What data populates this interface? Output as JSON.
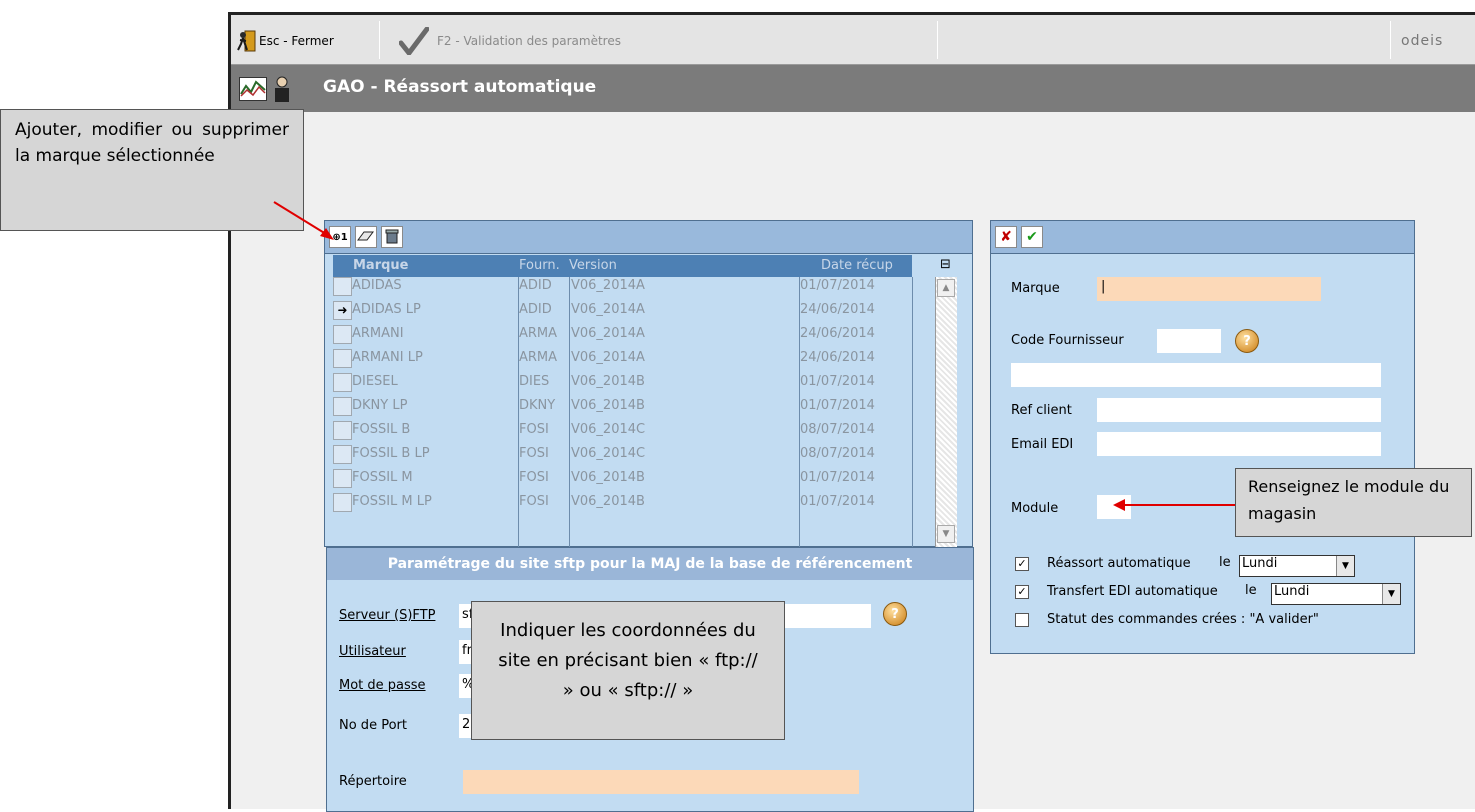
{
  "toolbar": {
    "close_label": "Esc - Fermer",
    "validate_label": "F2 - Validation des paramètres",
    "logo": "odeis"
  },
  "window": {
    "title": "GAO - Réassort automatique"
  },
  "brand_grid": {
    "columns": [
      "Marque",
      "Fourn.",
      "Version",
      "Date récup"
    ],
    "rows": [
      [
        "ADIDAS",
        "ADID",
        "V06_2014A",
        "01/07/2014"
      ],
      [
        "ADIDAS LP",
        "ADID",
        "V06_2014A",
        "24/06/2014"
      ],
      [
        "ARMANI",
        "ARMA",
        "V06_2014A",
        "24/06/2014"
      ],
      [
        "ARMANI LP",
        "ARMA",
        "V06_2014A",
        "24/06/2014"
      ],
      [
        "DIESEL",
        "DIES",
        "V06_2014B",
        "01/07/2014"
      ],
      [
        "DKNY LP",
        "DKNY",
        "V06_2014B",
        "01/07/2014"
      ],
      [
        "FOSSIL B",
        "FOSI",
        "V06_2014C",
        "08/07/2014"
      ],
      [
        "FOSSIL B LP",
        "FOSI",
        "V06_2014C",
        "08/07/2014"
      ],
      [
        "FOSSIL M",
        "FOSI",
        "V06_2014B",
        "01/07/2014"
      ],
      [
        "FOSSIL M LP",
        "FOSI",
        "V06_2014B",
        "01/07/2014"
      ]
    ],
    "selected_row": 1
  },
  "sftp": {
    "header": "Paramétrage du site sftp pour la MAJ de la base de référencement",
    "server_label": "Serveur (S)FTP",
    "server_value": "sf",
    "user_label": "Utilisateur",
    "user_value": "fr",
    "password_label": "Mot de passe",
    "password_value": "%",
    "port_label": "No de Port",
    "port_value": "2",
    "directory_label": "Répertoire",
    "directory_value": ""
  },
  "detail": {
    "marque_label": "Marque",
    "marque_value": "|",
    "code_fournisseur_label": "Code Fournisseur",
    "code_fournisseur_value": "",
    "ref_client_label": "Ref client",
    "ref_client_value": "",
    "email_edi_label": "Email EDI",
    "email_edi_value": "",
    "module_label": "Module",
    "module_value": "",
    "reassort_label": "Réassort automatique",
    "reassort_checked": true,
    "reassort_le": "le",
    "reassort_day": "Lundi",
    "transfert_label": "Transfert EDI automatique",
    "transfert_checked": true,
    "transfert_le": "le",
    "transfert_day": "Lundi",
    "statut_label": "Statut des commandes crées : \"A valider\"",
    "statut_checked": false
  },
  "callouts": {
    "add_edit_delete": "Ajouter, modifier ou supprimer la marque sélectionnée",
    "module": "Renseignez le module du magasin",
    "coords": "Indiquer les coordonnées du site en précisant bien « ftp:// » ou « sftp:// »"
  },
  "colors": {
    "panel_bg": "#c2dcf2",
    "toolbar_blue": "#99b9dc",
    "grid_header": "#4d80b4",
    "input_highlight": "#fcd9b8",
    "arrow_red": "#e00000"
  }
}
